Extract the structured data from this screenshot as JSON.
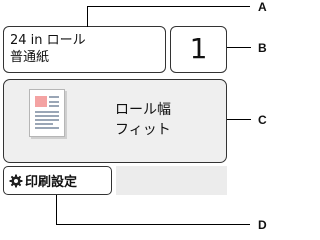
{
  "media": {
    "size_type": "24 in ロール",
    "paper": "普通紙"
  },
  "copies": {
    "value": "1"
  },
  "fit_button": {
    "line1": "ロール幅",
    "line2": "フィット"
  },
  "settings_button": {
    "label": "印刷設定",
    "icon": "gear-icon"
  },
  "callouts": [
    "A",
    "B",
    "C",
    "D"
  ],
  "colors": {
    "border": "#333333",
    "button_bg": "#efefef",
    "empty_bg": "#ececec"
  }
}
